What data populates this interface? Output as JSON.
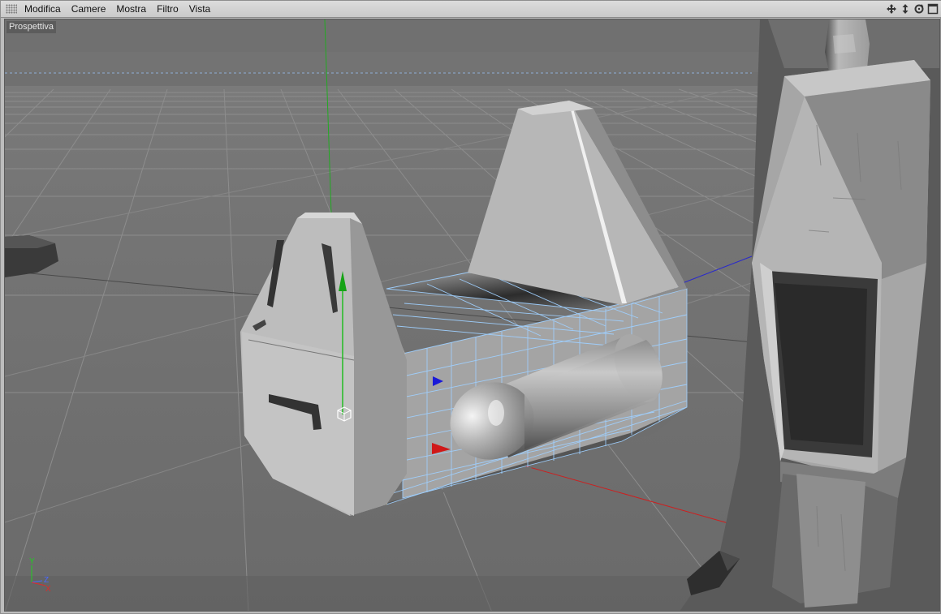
{
  "menubar": {
    "items": [
      {
        "label": "Modifica",
        "name": "menu-modifica"
      },
      {
        "label": "Camere",
        "name": "menu-camere"
      },
      {
        "label": "Mostra",
        "name": "menu-mostra"
      },
      {
        "label": "Filtro",
        "name": "menu-filtro"
      },
      {
        "label": "Vista",
        "name": "menu-vista"
      }
    ],
    "nav_icons": [
      "move-view-icon",
      "dolly-view-icon",
      "rotate-view-icon",
      "maximize-view-icon"
    ]
  },
  "viewport": {
    "label": "Prospettiva",
    "axis_gizmo": {
      "y": "Y",
      "z": "Z",
      "x": "X"
    }
  },
  "colors": {
    "x_axis": "#d01010",
    "y_axis": "#10b010",
    "z_axis": "#1010d0",
    "selection_wire": "#9fd0ff",
    "ui_bar": "#d0d0d0"
  }
}
